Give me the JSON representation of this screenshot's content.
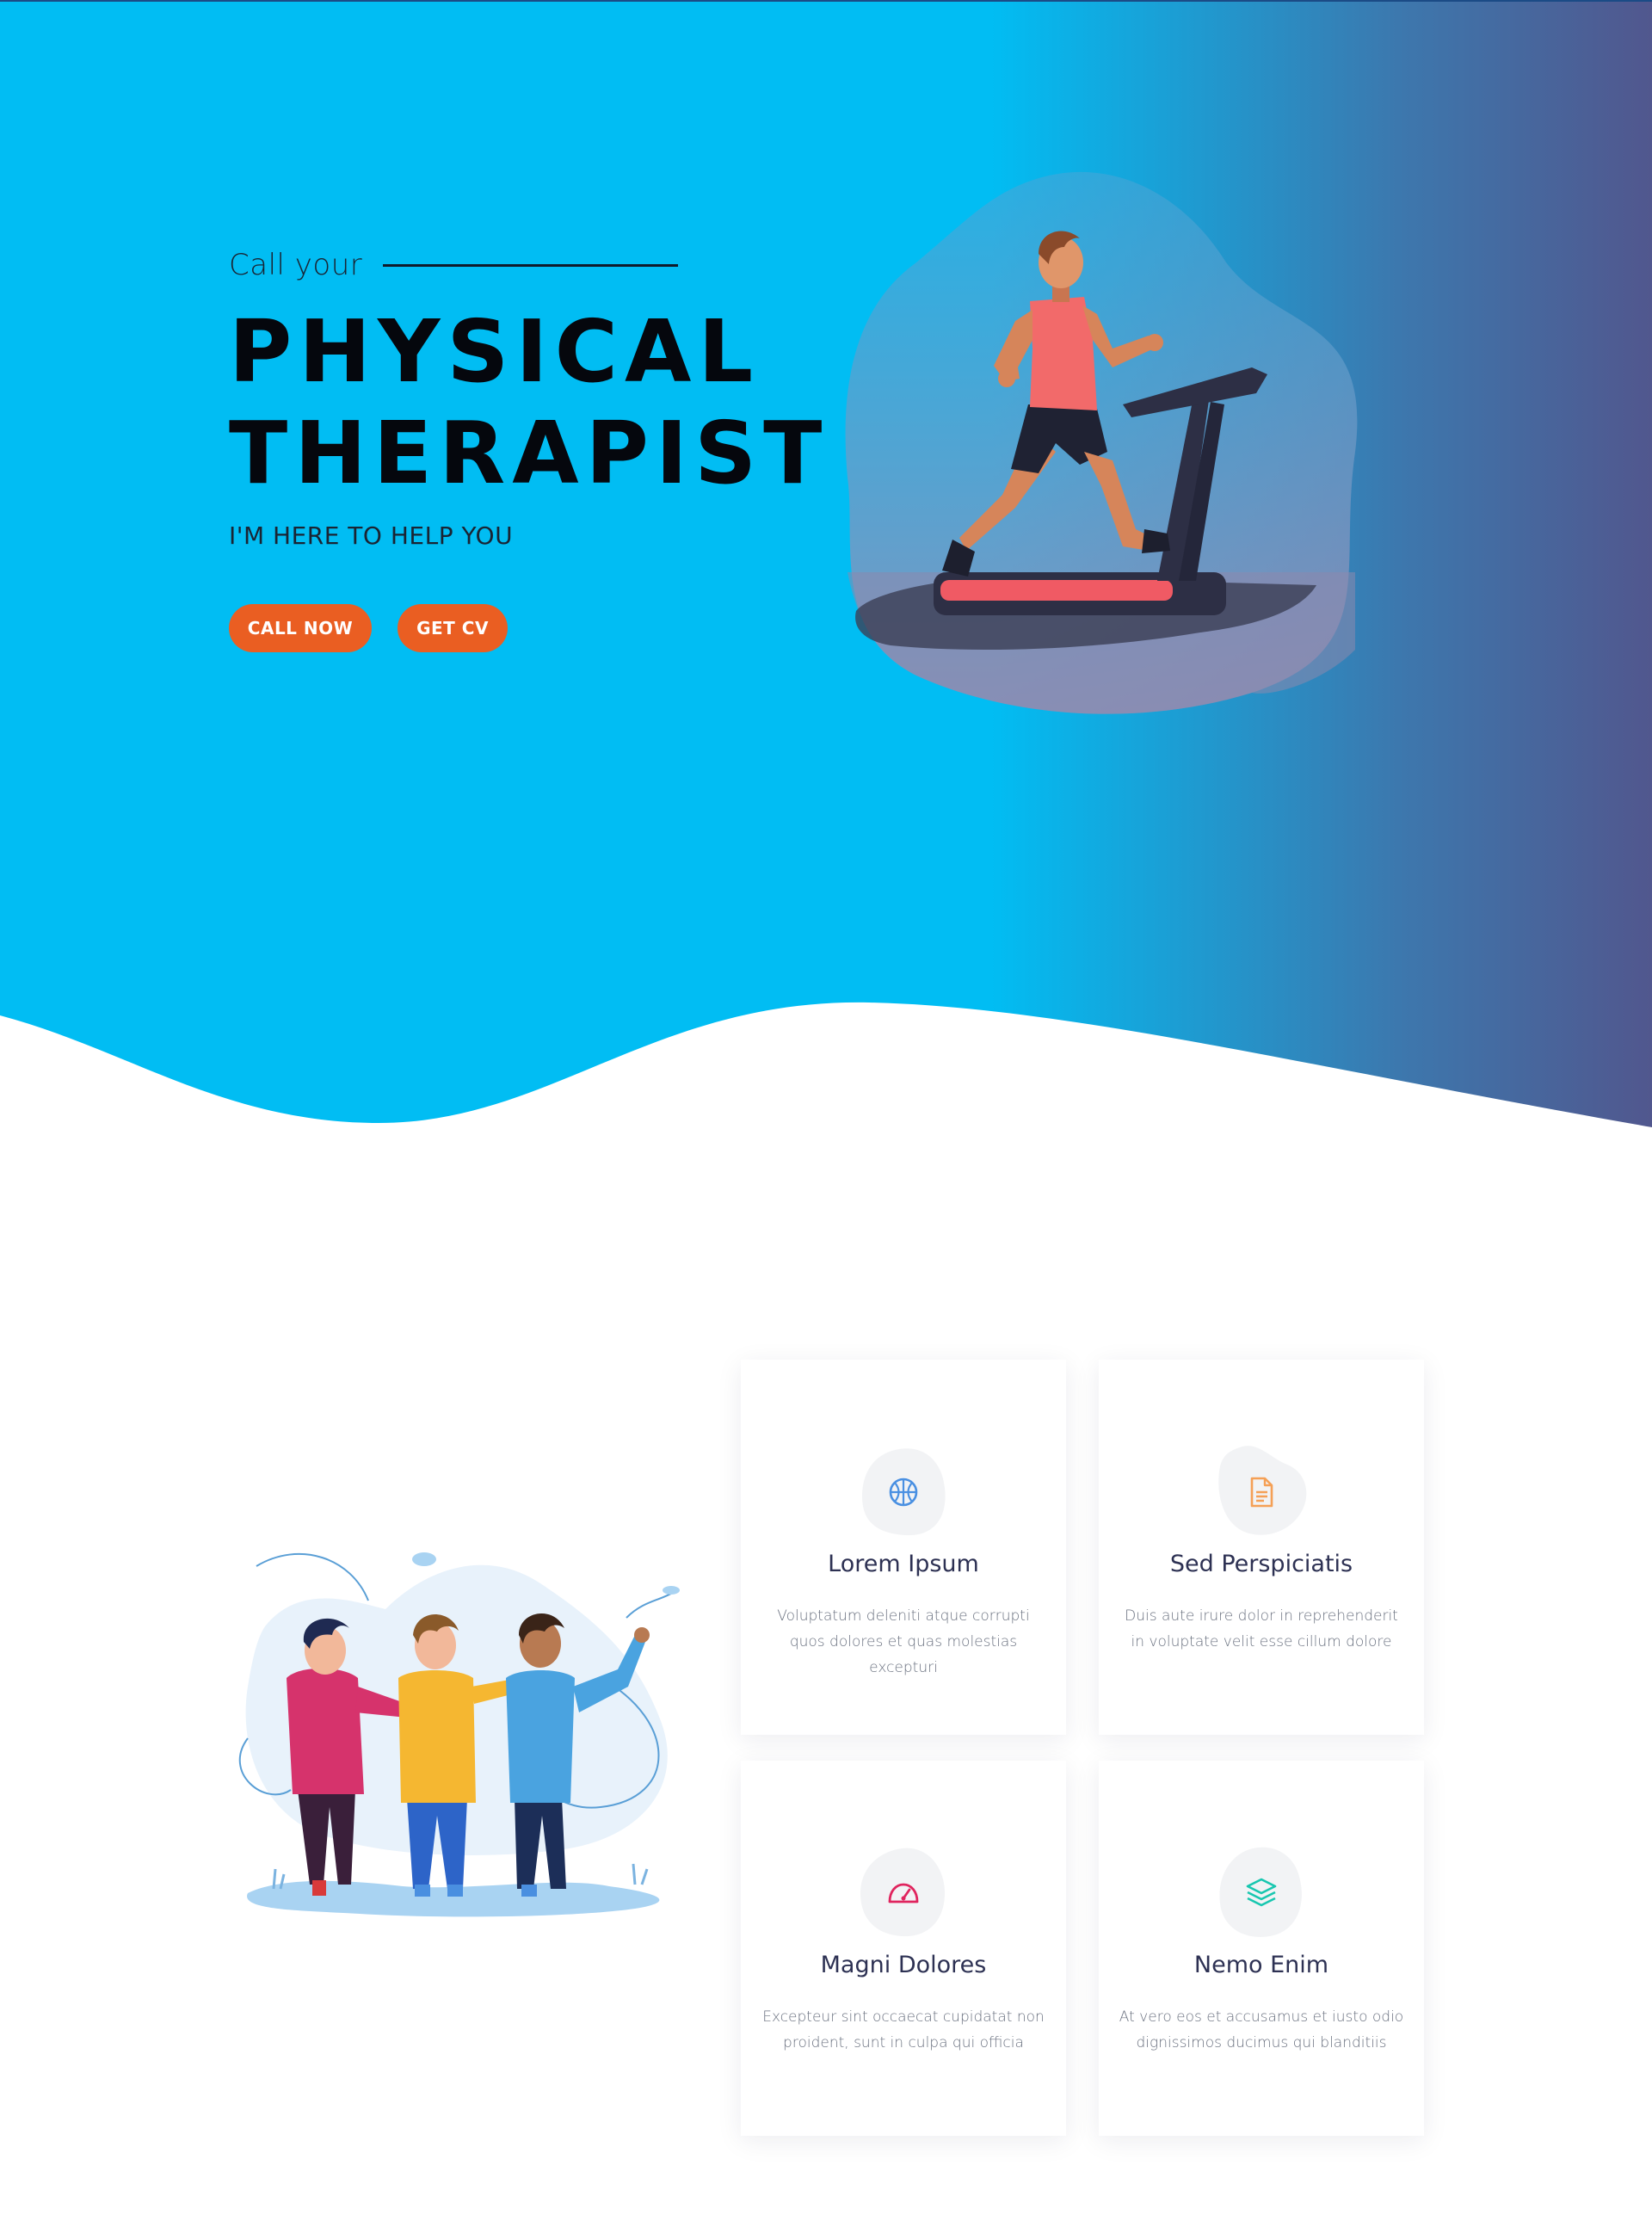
{
  "hero": {
    "eyebrow": "Call your",
    "title_line1": "PHYSICAL",
    "title_line2": "THERAPIST",
    "subtitle": "I'M HERE TO HELP YOU",
    "buttons": {
      "call_now": "CALL NOW",
      "get_cv": "GET CV"
    }
  },
  "features": {
    "cards": [
      {
        "title": "Lorem Ipsum",
        "text": "Voluptatum deleniti atque corrupti quos dolores et quas molestias excepturi",
        "icon": "basketball-icon",
        "icon_color": "#4a90e2"
      },
      {
        "title": "Sed Perspiciatis",
        "text": "Duis aute irure dolor in reprehenderit in voluptate velit esse cillum dolore",
        "icon": "document-icon",
        "icon_color": "#f5a056"
      },
      {
        "title": "Magni Dolores",
        "text": "Excepteur sint occaecat cupidatat non proident, sunt in culpa qui officia",
        "icon": "speedometer-icon",
        "icon_color": "#e0245e"
      },
      {
        "title": "Nemo Enim",
        "text": "At vero eos et accusamus et iusto odio dignissimos ducimus qui blanditiis",
        "icon": "layers-icon",
        "icon_color": "#19c7b0"
      }
    ]
  },
  "colors": {
    "hero_blue": "#01bdf3",
    "hero_purple": "#51578e",
    "button_orange": "#ea5e22",
    "card_title": "#2d3153"
  }
}
